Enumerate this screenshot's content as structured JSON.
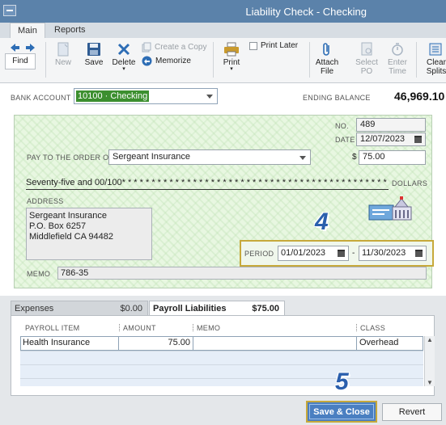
{
  "window": {
    "title": "Liability Check - Checking"
  },
  "ribbon": {
    "tabs": [
      "Main",
      "Reports"
    ],
    "find_label": "Find",
    "new_label": "New",
    "save_label": "Save",
    "delete_label": "Delete",
    "create_copy_label": "Create a Copy",
    "memorize_label": "Memorize",
    "print_label": "Print",
    "print_later_label": "Print Later",
    "attach_file_label": [
      "Attach",
      "File"
    ],
    "select_po_label": [
      "Select",
      "PO"
    ],
    "enter_time_label": [
      "Enter",
      "Time"
    ],
    "clear_splits_label": [
      "Clear",
      "Splits"
    ]
  },
  "account": {
    "label": "BANK ACCOUNT",
    "value": "10100 · Checking",
    "ending_balance_label": "ENDING BALANCE",
    "ending_balance": "46,969.10"
  },
  "check": {
    "no_label": "NO.",
    "no": "489",
    "date_label": "DATE",
    "date": "12/07/2023",
    "pay_to_label": "PAY TO THE ORDER OF",
    "payee": "Sergeant Insurance",
    "dollar_sign": "$",
    "amount": "75.00",
    "amount_words": "Seventy-five and 00/100* * * * * * * * * * * * * * * * * * * * * * * * * * * * * * * * * * * * * * * * * * * * * * * * * * * * *",
    "dollars_label": "DOLLARS",
    "address_label": "ADDRESS",
    "address_lines": [
      "Sergeant Insurance",
      "P.O. Box 6257",
      "Middlefield CA 94482"
    ],
    "period_label": "PERIOD",
    "period_from": "01/01/2023",
    "period_sep": "-",
    "period_to": "11/30/2023",
    "memo_label": "MEMO",
    "memo": "786-35"
  },
  "steps": {
    "period": "4",
    "save": "5"
  },
  "lower_tabs": {
    "expenses_label": "Expenses",
    "expenses_amount": "$0.00",
    "payroll_label": "Payroll Liabilities",
    "payroll_amount": "$75.00"
  },
  "grid": {
    "headers": [
      "PAYROLL ITEM",
      "AMOUNT",
      "MEMO",
      "CLASS"
    ],
    "rows": [
      {
        "item": "Health Insurance",
        "amount": "75.00",
        "memo": "",
        "class": "Overhead"
      }
    ]
  },
  "buttons": {
    "save_close": "Save & Close",
    "revert": "Revert"
  }
}
